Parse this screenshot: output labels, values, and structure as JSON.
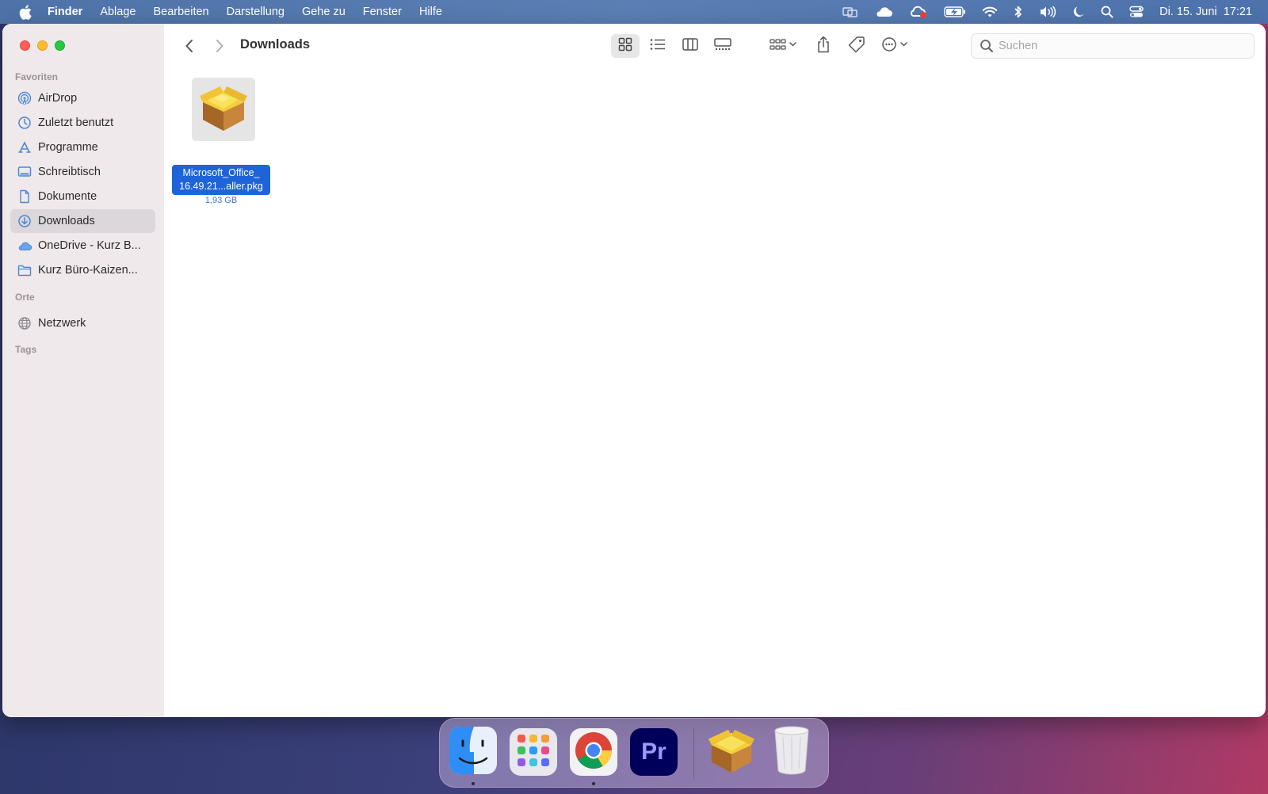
{
  "menubar": {
    "app_name": "Finder",
    "items": [
      "Ablage",
      "Bearbeiten",
      "Darstellung",
      "Gehe zu",
      "Fenster",
      "Hilfe"
    ],
    "clock": "Di. 15. Juni  17:21"
  },
  "sidebar": {
    "favorites_title": "Favoriten",
    "favorites": [
      {
        "label": "AirDrop",
        "icon": "airdrop-icon"
      },
      {
        "label": "Zuletzt benutzt",
        "icon": "clock-icon"
      },
      {
        "label": "Programme",
        "icon": "applications-icon"
      },
      {
        "label": "Schreibtisch",
        "icon": "desktop-icon"
      },
      {
        "label": "Dokumente",
        "icon": "document-icon"
      },
      {
        "label": "Downloads",
        "icon": "download-icon",
        "selected": true
      },
      {
        "label": "OneDrive - Kurz B...",
        "icon": "cloud-icon"
      },
      {
        "label": "Kurz Büro-Kaizen...",
        "icon": "folder-icon"
      }
    ],
    "places_title": "Orte",
    "places": [
      {
        "label": "Netzwerk",
        "icon": "network-icon"
      }
    ],
    "tags_title": "Tags"
  },
  "toolbar": {
    "title": "Downloads",
    "view_mode": "icons",
    "search_placeholder": "Suchen"
  },
  "files": [
    {
      "name_line1": "Microsoft_Office_",
      "name_line2": "16.49.21...aller.pkg",
      "size": "1,93 GB",
      "selected": true,
      "icon": "package-icon"
    }
  ],
  "dock": {
    "apps": [
      "finder-icon",
      "launchpad-icon",
      "chrome-icon",
      "premiere-icon",
      "package-icon",
      "trash-icon"
    ],
    "premiere_label": "Pr"
  },
  "colors": {
    "accent": "#1e64d8",
    "menubar": "#5377ae",
    "sidebar": "#efe9ec"
  }
}
